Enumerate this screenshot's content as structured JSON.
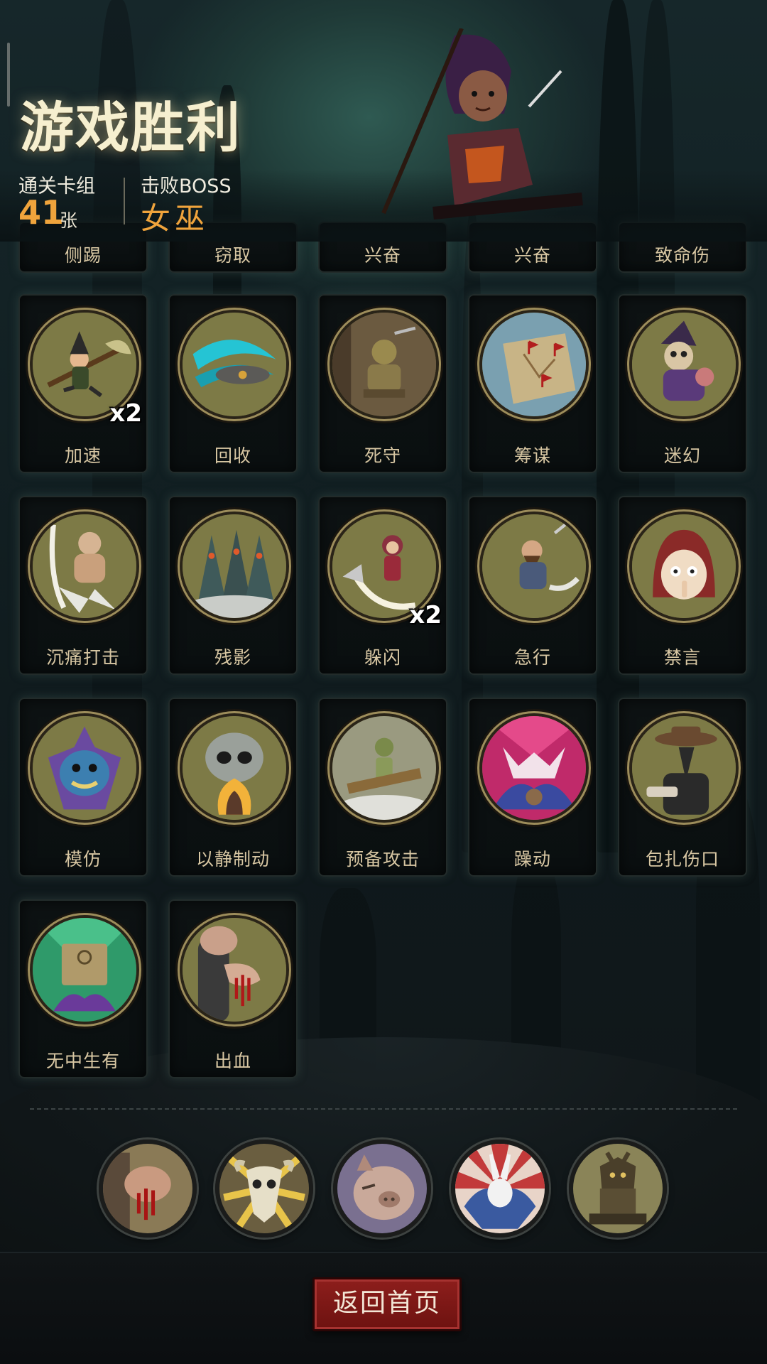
{
  "header": {
    "title": "游戏胜利",
    "deck_label": "通关卡组",
    "deck_count": "41",
    "deck_unit": "张",
    "boss_label": "击败BOSS",
    "boss_name": "女巫"
  },
  "cards": [
    {
      "name": "侧踢"
    },
    {
      "name": "窃取"
    },
    {
      "name": "兴奋"
    },
    {
      "name": "兴奋"
    },
    {
      "name": "致命伤"
    },
    {
      "name": "加速",
      "count": "x2",
      "icon": "witch-on-broom-icon"
    },
    {
      "name": "回收",
      "icon": "spinning-disc-icon"
    },
    {
      "name": "死守",
      "icon": "goblin-guard-icon"
    },
    {
      "name": "筹谋",
      "icon": "battle-map-icon"
    },
    {
      "name": "迷幻",
      "icon": "witch-trio-icon"
    },
    {
      "name": "沉痛打击",
      "icon": "brute-strike-icon"
    },
    {
      "name": "残影",
      "icon": "hooded-clones-icon"
    },
    {
      "name": "躲闪",
      "count": "x2",
      "icon": "dodging-girl-icon"
    },
    {
      "name": "急行",
      "icon": "dashing-dwarf-icon"
    },
    {
      "name": "禁言",
      "icon": "hushing-hood-icon"
    },
    {
      "name": "模仿",
      "icon": "masked-goblin-icon"
    },
    {
      "name": "以静制动",
      "icon": "skull-flame-icon"
    },
    {
      "name": "预备攻击",
      "icon": "puppet-icon"
    },
    {
      "name": "躁动",
      "icon": "frenzy-beast-icon"
    },
    {
      "name": "包扎伤口",
      "icon": "plague-doctor-icon"
    },
    {
      "name": "无中生有",
      "icon": "tome-flower-icon"
    },
    {
      "name": "出血",
      "icon": "bleeding-hand-icon"
    }
  ],
  "relics": [
    {
      "icon": "bleeding-hand-icon"
    },
    {
      "icon": "bull-skull-icon"
    },
    {
      "icon": "pig-mask-icon"
    },
    {
      "icon": "jester-rabbit-icon"
    },
    {
      "icon": "stone-idol-icon"
    }
  ],
  "footer": {
    "home_button": "返回首页"
  },
  "colors": {
    "accent_orange": "#f0a43c",
    "title": "#f6efcf",
    "card_label": "#d8c7a3",
    "button_red": "#8d1e1c",
    "art_olive": "#7d7a46"
  }
}
